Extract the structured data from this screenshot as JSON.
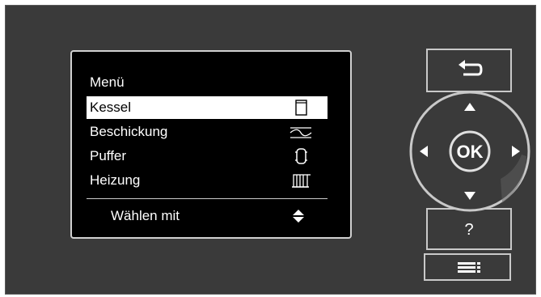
{
  "menu": {
    "title": "Menü",
    "items": [
      {
        "label": "Kessel",
        "selected": true,
        "icon": "boiler-icon"
      },
      {
        "label": "Beschickung",
        "selected": false,
        "icon": "feed-icon"
      },
      {
        "label": "Puffer",
        "selected": false,
        "icon": "buffer-tank-icon"
      },
      {
        "label": "Heizung",
        "selected": false,
        "icon": "radiator-icon"
      }
    ],
    "hint": "Wählen mit",
    "hint_icon": "up-down-arrows-icon"
  },
  "controls": {
    "back_icon": "back-arrow-icon",
    "ok_label": "OK",
    "help_label": "?",
    "menu_icon": "menu-list-icon"
  },
  "colors": {
    "panel": "#3a3a3a",
    "screen": "#000000",
    "selection": "#ffffff",
    "border": "#c9c9c9"
  }
}
